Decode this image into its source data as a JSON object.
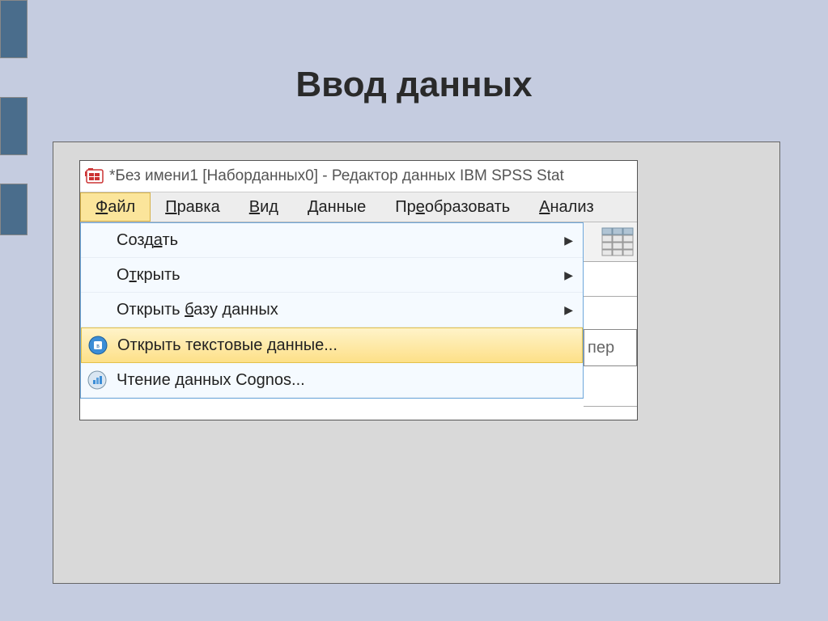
{
  "slide": {
    "title": "Ввод данных"
  },
  "window": {
    "title": "*Без имени1 [Наборданных0] - Редактор данных IBM SPSS Stat"
  },
  "menubar": {
    "items": [
      {
        "pre": "",
        "u": "Ф",
        "post": "айл",
        "active": true
      },
      {
        "pre": "",
        "u": "П",
        "post": "равка",
        "active": false
      },
      {
        "pre": "",
        "u": "В",
        "post": "ид",
        "active": false
      },
      {
        "pre": "",
        "u": "Д",
        "post": "анные",
        "active": false
      },
      {
        "pre": "Пр",
        "u": "е",
        "post": "образовать",
        "active": false
      },
      {
        "pre": "",
        "u": "А",
        "post": "нализ",
        "active": false
      }
    ]
  },
  "dropdown": {
    "items": [
      {
        "pre": "Созд",
        "u": "а",
        "post": "ть",
        "arrow": true,
        "icon": "",
        "highlight": false
      },
      {
        "pre": "О",
        "u": "т",
        "post": "крыть",
        "arrow": true,
        "icon": "",
        "highlight": false
      },
      {
        "pre": "Открыть ",
        "u": "б",
        "post": "азу данных",
        "arrow": true,
        "icon": "",
        "highlight": false
      },
      {
        "pre": "Открыть текстовые данные...",
        "u": "",
        "post": "",
        "arrow": false,
        "icon": "text-doc",
        "highlight": true
      },
      {
        "pre": "Чтение данных Co",
        "u": "g",
        "post": "nos...",
        "arrow": false,
        "icon": "chart",
        "highlight": false
      }
    ]
  },
  "fragments": {
    "partial_cell_text": "пер"
  }
}
